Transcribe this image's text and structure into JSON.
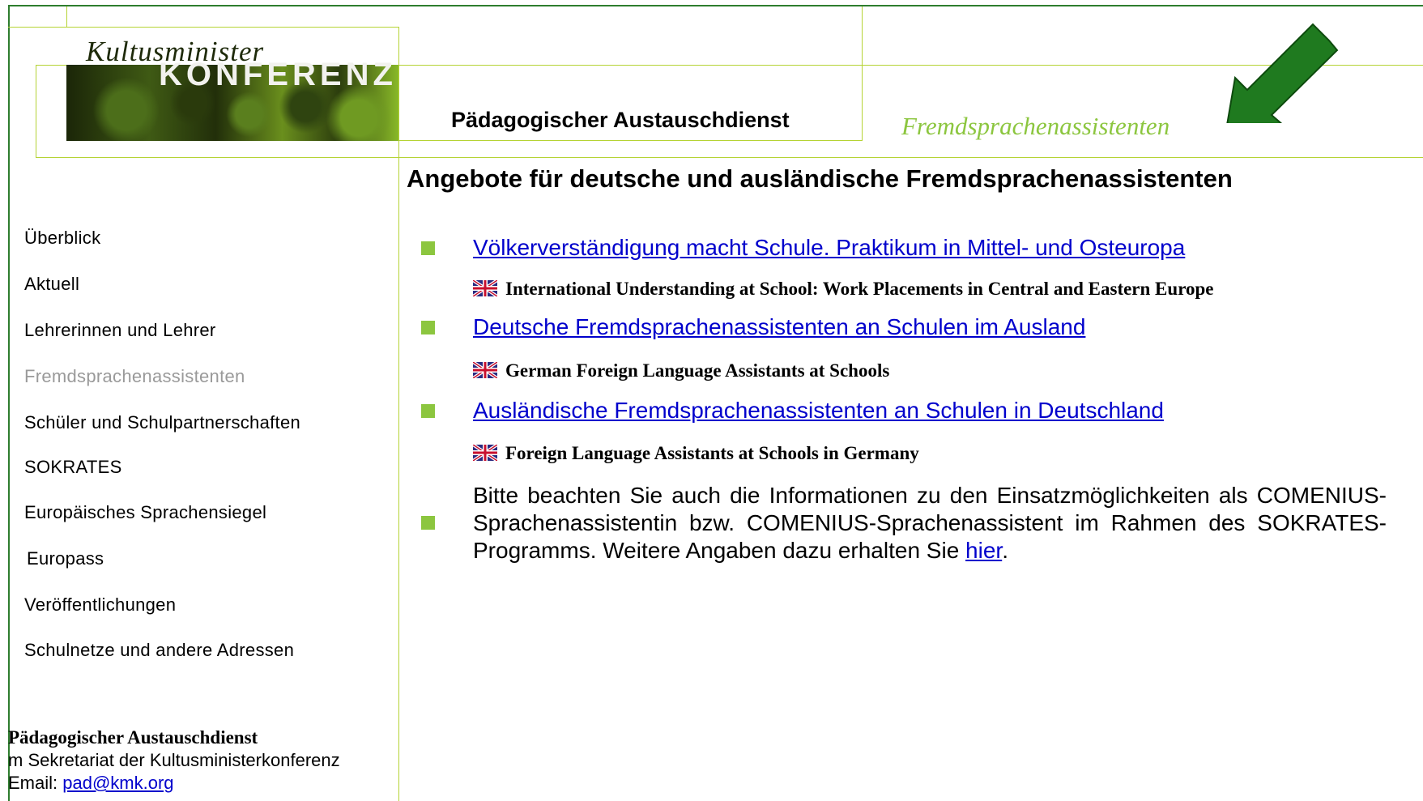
{
  "logo": {
    "line1": "Kultusminister",
    "line2": "KONFERENZ"
  },
  "header": {
    "title": "Pädagogischer Austauschdienst",
    "section": "Fremdsprachenassistenten"
  },
  "sidebar": {
    "items": [
      {
        "label": "Überblick"
      },
      {
        "label": "Aktuell"
      },
      {
        "label": "Lehrerinnen und Lehrer"
      },
      {
        "label": "Fremdsprachenassistenten"
      },
      {
        "label": "Schüler und Schulpartnerschaften"
      },
      {
        "label": "SOKRATES"
      },
      {
        "label": "Europäisches Sprachensiegel"
      },
      {
        "label": "Europass"
      },
      {
        "label": "Veröffentlichungen"
      },
      {
        "label": "Schulnetze und andere Adressen"
      }
    ]
  },
  "main": {
    "heading": "Angebote für deutsche und ausländische Fremdsprachenassistenten",
    "offers": [
      {
        "link": "Völkerverständigung macht Schule. Praktikum in Mittel- und Osteuropa",
        "english": "International Understanding at School: Work Placements in Central and Eastern Europe"
      },
      {
        "link": "Deutsche Fremdsprachenassistenten an Schulen im Ausland",
        "english": "German Foreign Language Assistants at Schools"
      },
      {
        "link": "Ausländische Fremdsprachenassistenten an Schulen in Deutschland",
        "english": "Foreign Language Assistants at Schools in Germany"
      }
    ],
    "note": {
      "text": "Bitte beachten Sie auch die Informationen zu den Einsatzmöglichkeiten als COMENIUS-Sprachenassistentin bzw. COMENIUS-Sprachenassistent im Rahmen des SOKRATES-Programms. Weitere Angaben dazu erhalten Sie ",
      "link": "hier",
      "end": "."
    }
  },
  "footer": {
    "name": "Pädagogischer Austauschdienst",
    "line2": "m Sekretariat der Kultusministerkonferenz",
    "email_label": "Email: ",
    "email": "pad@kmk.org"
  },
  "colors": {
    "accent_green": "#8cc63f",
    "frame_green": "#b5d334",
    "arrow_green": "#1f7a1f",
    "link_blue": "#0000cc"
  },
  "icons": [
    "green-arrow-icon",
    "uk-flag-icon",
    "bullet-square-icon"
  ]
}
